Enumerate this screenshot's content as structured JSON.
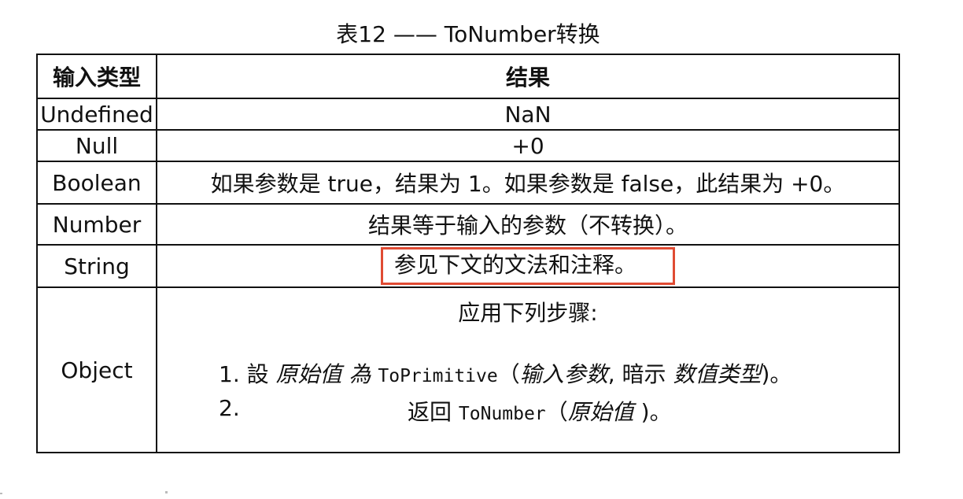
{
  "caption": "表12 —— ToNumber转换",
  "headers": {
    "input_type": "输入类型",
    "result": "结果"
  },
  "rows": [
    {
      "type": "Undefined",
      "result": "NaN"
    },
    {
      "type": "Null",
      "result": "+0"
    },
    {
      "type": "Boolean",
      "result": "如果参数是 true，结果为 1。如果参数是 false，此结果为 +0。"
    },
    {
      "type": "Number",
      "result": "结果等于输入的参数（不转换）。"
    },
    {
      "type": "String",
      "result": "参见下文的文法和注释。"
    }
  ],
  "object_row": {
    "type": "Object",
    "intro": "应用下列步骤:",
    "step1": {
      "num": "1.",
      "t1": "設",
      "var1": "原始值",
      "t2": "為",
      "code": "ToPrimitive",
      "paren_open": "（",
      "arg": "输入参数",
      "sep": ", 暗示",
      "hint": "数值类型",
      "paren_close": ")。"
    },
    "step2": {
      "num": "2.",
      "t1": "返回",
      "code": "ToNumber",
      "paren_open": "（",
      "var": "原始值",
      "paren_close": ")。"
    }
  },
  "colors": {
    "highlight_border": "#e04b33",
    "table_border": "#111111"
  }
}
